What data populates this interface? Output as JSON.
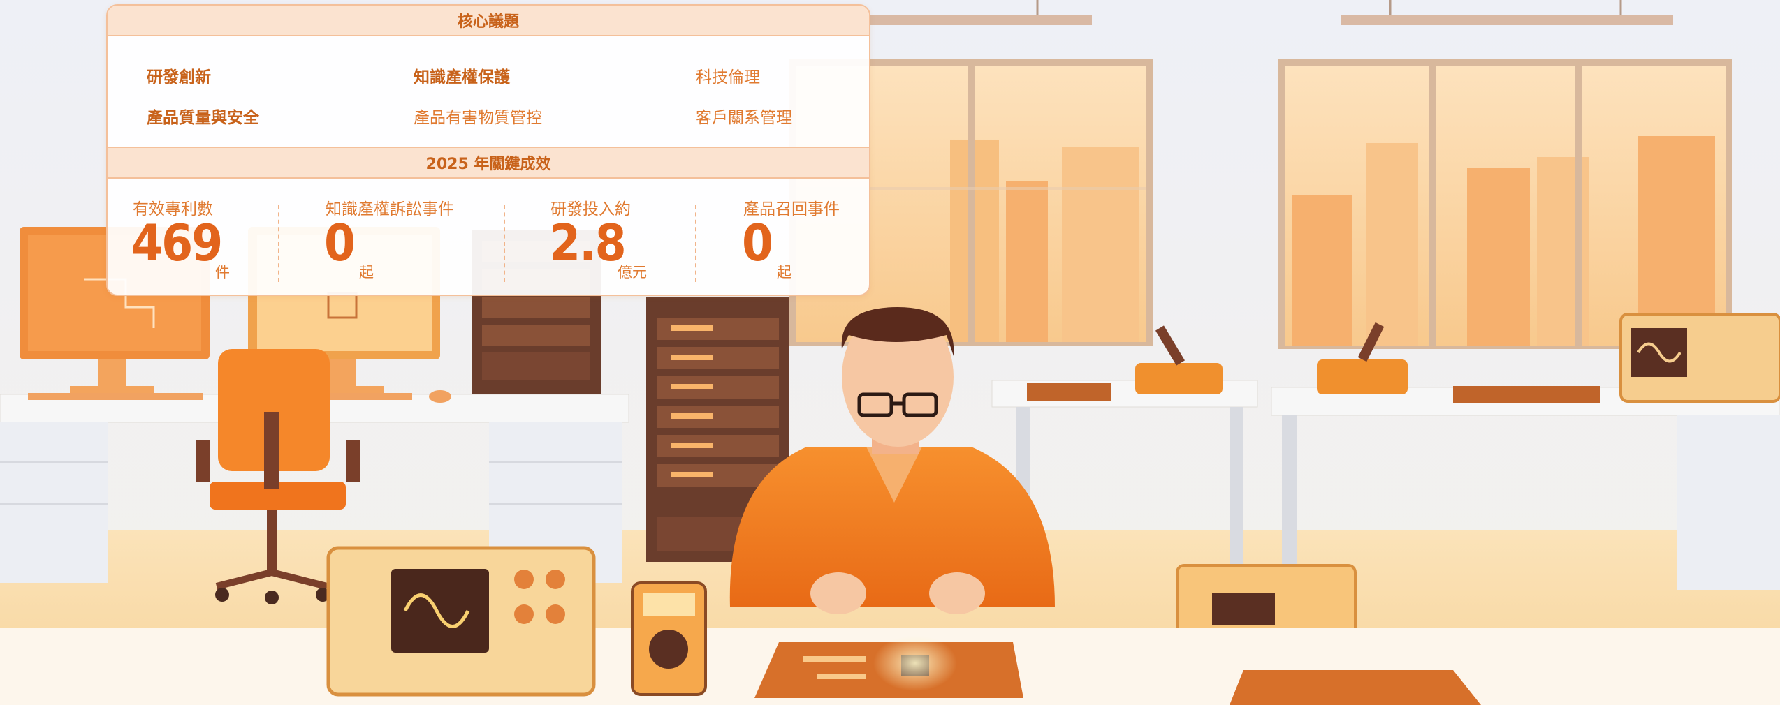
{
  "colors": {
    "accent": "#e2641c",
    "accent_light": "#fbe3d0",
    "border": "#f4c09a",
    "text_orange": "#e07a30"
  },
  "card": {
    "issues_header": "核心議題",
    "issues": [
      {
        "label": "研發創新",
        "emphasis": true
      },
      {
        "label": "知識產權保護",
        "emphasis": true
      },
      {
        "label": "科技倫理",
        "emphasis": false
      },
      {
        "label": "產品質量與安全",
        "emphasis": true
      },
      {
        "label": "產品有害物質管控",
        "emphasis": false
      },
      {
        "label": "客戶關系管理",
        "emphasis": false
      }
    ],
    "kpi_header": "2025 年關鍵成效",
    "kpis": [
      {
        "label": "有效專利數",
        "value": "469",
        "unit": "件"
      },
      {
        "label": "知識產權訴訟事件",
        "value": "0",
        "unit": "起"
      },
      {
        "label": "研發投入約",
        "value": "2.8",
        "unit": "億元"
      },
      {
        "label": "產品召回事件",
        "value": "0",
        "unit": "起"
      }
    ]
  },
  "scene_icons": [
    "monitor-icon",
    "office-chair-icon",
    "server-rack-icon",
    "engineer-icon",
    "oscilloscope-icon",
    "multimeter-icon",
    "circuit-board-icon",
    "soldering-iron-icon",
    "signal-generator-icon",
    "window-icon",
    "ceiling-lamp-icon"
  ]
}
